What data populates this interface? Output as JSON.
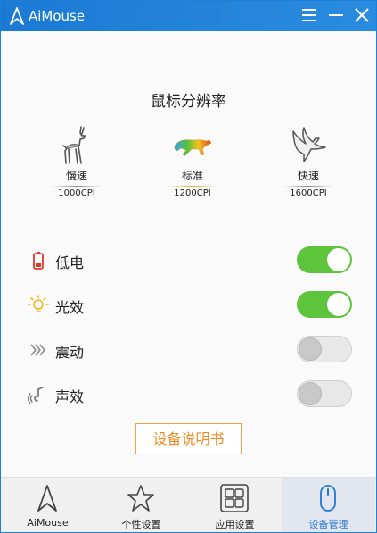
{
  "app": {
    "title": "AiMouse"
  },
  "colors": {
    "titlebar": "#1b7ad4",
    "toggle_on": "#5cc53c",
    "toggle_off": "#e8e8e8",
    "accent_orange": "#f08a20",
    "active_tab": "#2478d4"
  },
  "dpi": {
    "title": "鼠标分辨率",
    "options": [
      {
        "name": "慢速",
        "value": "1000CPI",
        "icon": "deer-icon"
      },
      {
        "name": "标准",
        "value": "1200CPI",
        "icon": "leopard-icon",
        "selected": true
      },
      {
        "name": "快速",
        "value": "1600CPI",
        "icon": "eagle-icon"
      }
    ]
  },
  "settings": {
    "battery": {
      "label": "低电",
      "on": true,
      "icon": "battery-icon"
    },
    "light": {
      "label": "光效",
      "on": true,
      "icon": "lightbulb-icon"
    },
    "vibrate": {
      "label": "震动",
      "on": false,
      "icon": "vibrate-icon"
    },
    "sound": {
      "label": "声效",
      "on": false,
      "icon": "sound-icon"
    }
  },
  "manual_button": "设备说明书",
  "nav": {
    "items": [
      {
        "label": "AiMouse",
        "icon": "aimouse-logo-icon"
      },
      {
        "label": "个性设置",
        "icon": "star-icon"
      },
      {
        "label": "应用设置",
        "icon": "grid-icon"
      },
      {
        "label": "设备管理",
        "icon": "mouse-icon",
        "active": true
      }
    ]
  }
}
